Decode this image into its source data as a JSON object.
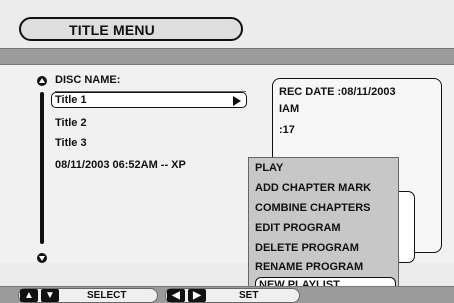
{
  "window": {
    "title": "TITLE MENU"
  },
  "disc": {
    "name_label": "DISC NAME:"
  },
  "titles": [
    {
      "label": "Title 1",
      "selected": true
    },
    {
      "label": "Title 2",
      "selected": false
    },
    {
      "label": "Title 3",
      "selected": false
    },
    {
      "label": "08/11/2003 06:52AM -- XP",
      "selected": false
    }
  ],
  "info": {
    "lines": [
      "REC DATE  :08/11/2003",
      "IAM",
      ":17"
    ]
  },
  "menu": {
    "items": [
      "PLAY",
      "ADD CHAPTER MARK",
      "COMBINE CHAPTERS",
      "EDIT PROGRAM",
      "DELETE PROGRAM",
      "RENAME PROGRAM",
      "NEW PLAYLIST"
    ],
    "selected_index": 6
  },
  "footer": {
    "select_label": "SELECT",
    "set_label": "SET",
    "up_icon": "▲",
    "down_icon": "▼",
    "left_icon": "◀",
    "right_icon": "▶"
  },
  "colors": {
    "background": "#ececec",
    "accent": "#9b9b9b",
    "text": "#111111",
    "menu_bg": "#c7c7c7",
    "highlight": "#ffffff"
  }
}
